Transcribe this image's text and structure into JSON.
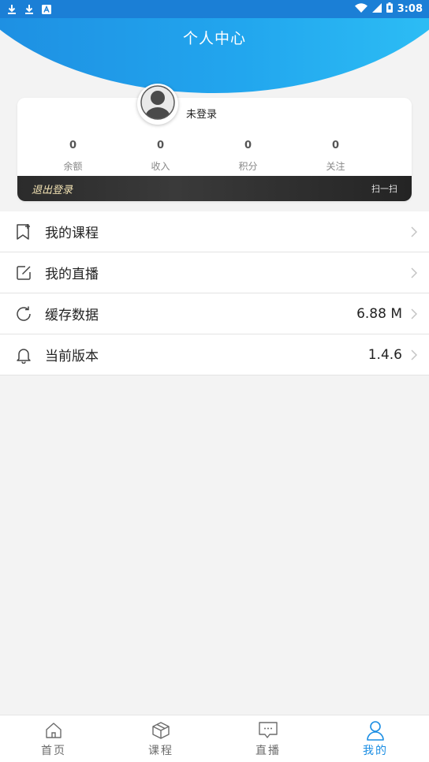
{
  "status_bar": {
    "time": "3:08",
    "left_icons": [
      "download-icon",
      "download-icon",
      "app-notification-icon"
    ],
    "right_icons": [
      "wifi-icon",
      "signal-icon",
      "battery-icon"
    ]
  },
  "header": {
    "title": "个人中心"
  },
  "profile": {
    "login_status": "未登录",
    "avatar_icon": "avatar-placeholder-icon",
    "stats": [
      {
        "value": "0",
        "label": "余额"
      },
      {
        "value": "0",
        "label": "收入"
      },
      {
        "value": "0",
        "label": "积分"
      },
      {
        "value": "0",
        "label": "关注"
      }
    ],
    "logout_label": "退出登录",
    "scan_label": "扫一扫"
  },
  "menu": [
    {
      "icon": "bookmark-plus-icon",
      "label": "我的课程",
      "value": ""
    },
    {
      "icon": "edit-square-icon",
      "label": "我的直播",
      "value": ""
    },
    {
      "icon": "refresh-icon",
      "label": "缓存数据",
      "value": "6.88 M"
    },
    {
      "icon": "bell-icon",
      "label": "当前版本",
      "value": "1.4.6"
    }
  ],
  "bottom_nav": [
    {
      "icon": "home-icon",
      "label": "首页",
      "active": false
    },
    {
      "icon": "box-icon",
      "label": "课程",
      "active": false
    },
    {
      "icon": "chat-bubble-icon",
      "label": "直播",
      "active": false
    },
    {
      "icon": "user-icon",
      "label": "我的",
      "active": true
    }
  ],
  "colors": {
    "accent": "#1a8de3",
    "header_gradient_start": "#1d8be0",
    "header_gradient_end": "#2fc3f6",
    "card_dark": "#2b2b2b",
    "logout_text": "#f2e2b3"
  }
}
